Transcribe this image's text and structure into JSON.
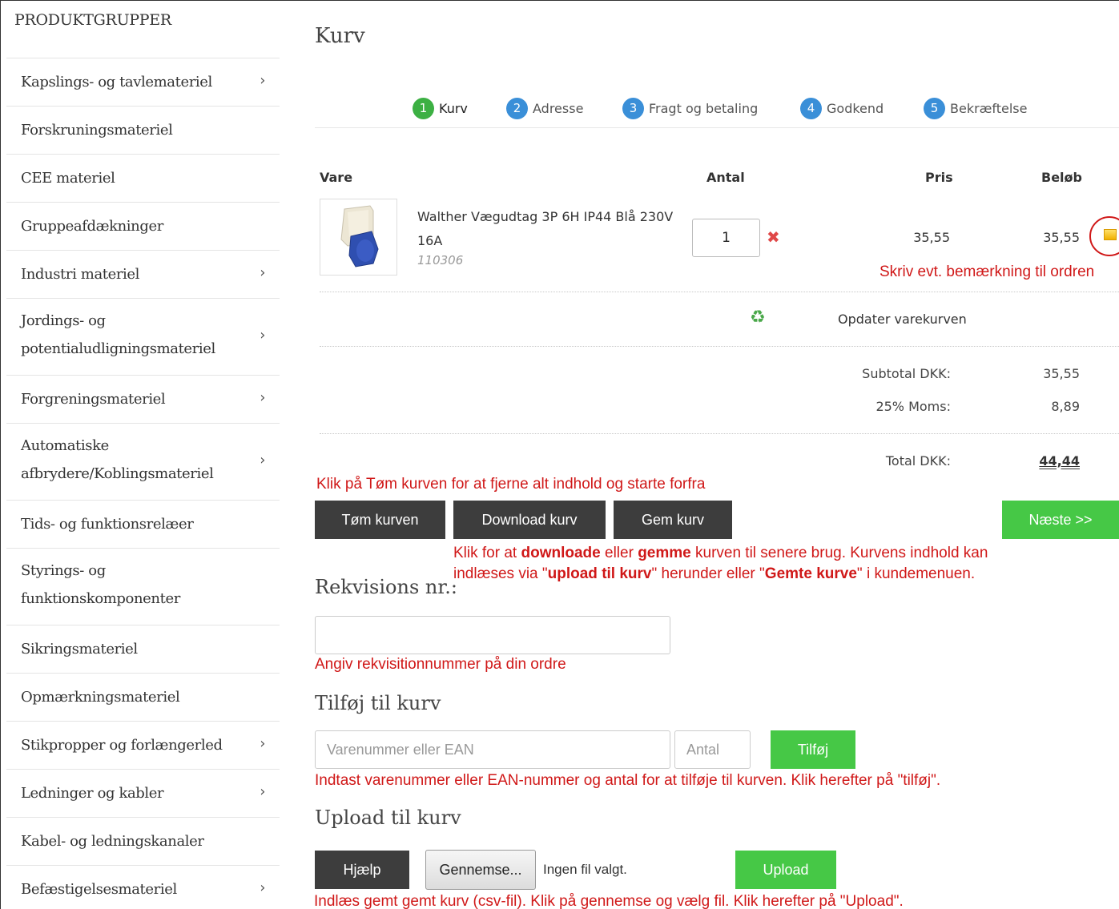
{
  "sidebar": {
    "title": "PRODUKTGRUPPER",
    "items": [
      {
        "label": "Kapslings- og tavlemateriel",
        "chevron": "›"
      },
      {
        "label": "Forskruningsmateriel",
        "chevron": ""
      },
      {
        "label": "CEE materiel",
        "chevron": ""
      },
      {
        "label": "Gruppeafdækninger",
        "chevron": ""
      },
      {
        "label": "Industri materiel",
        "chevron": "›"
      },
      {
        "label_line1": "Jordings- og",
        "label_line2": "potentialudligningsmateriel",
        "chevron": "›"
      },
      {
        "label": "Forgreningsmateriel",
        "chevron": "›"
      },
      {
        "label_line1": "Automatiske",
        "label_line2": "afbrydere/Koblingsmateriel",
        "chevron": "›"
      },
      {
        "label": "Tids- og funktionsrelæer",
        "chevron": ""
      },
      {
        "label_line1": "Styrings- og",
        "label_line2": "funktionskomponenter",
        "chevron": ""
      },
      {
        "label": "Sikringsmateriel",
        "chevron": ""
      },
      {
        "label": "Opmærkningsmateriel",
        "chevron": ""
      },
      {
        "label": "Stikpropper og forlængerled",
        "chevron": "›"
      },
      {
        "label": "Ledninger og kabler",
        "chevron": "›"
      },
      {
        "label": "Kabel- og ledningskanaler",
        "chevron": ""
      },
      {
        "label": "Befæstigelsesmateriel",
        "chevron": "›"
      }
    ]
  },
  "page": {
    "title": "Kurv"
  },
  "steps": [
    {
      "num": "1",
      "label": "Kurv",
      "color": "#3cb043"
    },
    {
      "num": "2",
      "label": "Adresse",
      "color": "#3a8fd8"
    },
    {
      "num": "3",
      "label": "Fragt og betaling",
      "color": "#3a8fd8"
    },
    {
      "num": "4",
      "label": "Godkend",
      "color": "#3a8fd8"
    },
    {
      "num": "5",
      "label": "Bekræftelse",
      "color": "#3a8fd8"
    }
  ],
  "cart": {
    "headers": {
      "item": "Vare",
      "qty": "Antal",
      "price": "Pris",
      "amount": "Beløb"
    },
    "line": {
      "name": "Walther Vægudtag 3P 6H IP44 Blå 230V 16A",
      "sku": "110306",
      "qty": "1",
      "price": "35,55",
      "amount": "35,55",
      "remove_icon": "✖",
      "note_icon": "note-icon"
    },
    "update_label": "Opdater varekurven",
    "refresh_icon": "♻",
    "subtotal_label": "Subtotal DKK:",
    "subtotal_value": "35,55",
    "vat_label": "25% Moms:",
    "vat_value": "8,89",
    "total_label": "Total DKK:",
    "total_value": "44,44"
  },
  "annotations": {
    "note": "Skriv evt. bemærkning til ordren",
    "empty": "Klik på Tøm kurven for at fjerne alt indhold og starte forfra",
    "save_p1": "Klik for at ",
    "save_b1": "downloade",
    "save_p2": " eller ",
    "save_b2": "gemme",
    "save_p3": " kurven til senere brug. Kurvens indhold kan",
    "save_p4": "indlæses via \"",
    "save_b3": "upload til kurv",
    "save_p5": "\"  herunder eller \"",
    "save_b4": "Gemte kurve",
    "save_p6": "\" i kundemenuen.",
    "rekv": "Angiv rekvisitionnummer på din ordre",
    "add": "Indtast varenummer eller EAN-nummer og antal for at tilføje til kurven. Klik herefter på \"tilføj\".",
    "upload": "Indlæs gemt gemt kurv (csv-fil). Klik på gennemse og vælg fil. Klik herefter på \"Upload\"."
  },
  "buttons": {
    "empty": "Tøm kurven",
    "download": "Download kurv",
    "save": "Gem kurv",
    "next": "Næste >>",
    "add": "Tilføj",
    "help": "Hjælp",
    "browse": "Gennemse...",
    "upload": "Upload"
  },
  "rekvisition": {
    "title": "Rekvisions nr.:",
    "value": ""
  },
  "add_to_cart": {
    "title": "Tilføj til kurv",
    "sku_placeholder": "Varenummer eller EAN",
    "qty_placeholder": "Antal"
  },
  "upload": {
    "title": "Upload til kurv",
    "no_file": "Ingen fil valgt."
  }
}
